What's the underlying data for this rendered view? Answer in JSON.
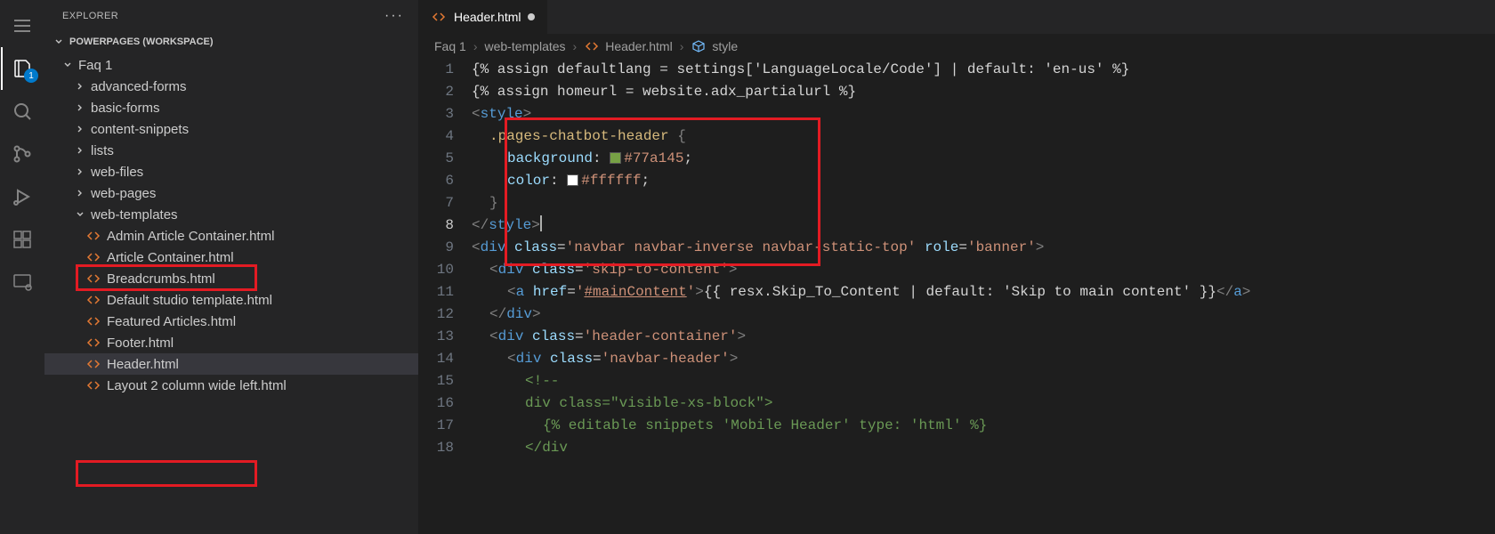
{
  "activityBar": {
    "explorerBadge": "1"
  },
  "sidebar": {
    "title": "EXPLORER",
    "section": "POWERPAGES (WORKSPACE)",
    "tree": [
      {
        "name": "Faq 1",
        "kind": "folder",
        "expanded": true,
        "depth": 0
      },
      {
        "name": "advanced-forms",
        "kind": "folder",
        "expanded": false,
        "depth": 1
      },
      {
        "name": "basic-forms",
        "kind": "folder",
        "expanded": false,
        "depth": 1
      },
      {
        "name": "content-snippets",
        "kind": "folder",
        "expanded": false,
        "depth": 1
      },
      {
        "name": "lists",
        "kind": "folder",
        "expanded": false,
        "depth": 1
      },
      {
        "name": "web-files",
        "kind": "folder",
        "expanded": false,
        "depth": 1
      },
      {
        "name": "web-pages",
        "kind": "folder",
        "expanded": false,
        "depth": 1
      },
      {
        "name": "web-templates",
        "kind": "folder",
        "expanded": true,
        "depth": 1
      },
      {
        "name": "Admin Article Container.html",
        "kind": "file",
        "depth": 2
      },
      {
        "name": "Article Container.html",
        "kind": "file",
        "depth": 2
      },
      {
        "name": "Breadcrumbs.html",
        "kind": "file",
        "depth": 2
      },
      {
        "name": "Default studio template.html",
        "kind": "file",
        "depth": 2
      },
      {
        "name": "Featured Articles.html",
        "kind": "file",
        "depth": 2
      },
      {
        "name": "Footer.html",
        "kind": "file",
        "depth": 2
      },
      {
        "name": "Header.html",
        "kind": "file",
        "depth": 2,
        "active": true
      },
      {
        "name": "Layout 2 column wide left.html",
        "kind": "file",
        "depth": 2
      }
    ]
  },
  "editor": {
    "tab": {
      "label": "Header.html",
      "dirty": true
    },
    "breadcrumb": [
      {
        "label": "Faq 1",
        "icon": null
      },
      {
        "label": "web-templates",
        "icon": null
      },
      {
        "label": "Header.html",
        "icon": "code"
      },
      {
        "label": "style",
        "icon": "block"
      }
    ],
    "code": {
      "l1": "{% assign defaultlang = settings['LanguageLocale/Code'] | default: 'en-us' %}",
      "l2": "{% assign homeurl = website.adx_partialurl %}",
      "l3_tag": "style",
      "l4_selector": ".pages-chatbot-header",
      "l5_prop": "background",
      "l5_val": "#77a145",
      "l6_prop": "color",
      "l6_val": "#ffffff",
      "l9_class": "navbar navbar-inverse navbar-static-top",
      "l9_role": "banner",
      "l10_class": "skip-to-content",
      "l11_href": "#mainContent",
      "l11_expr": "{{ resx.Skip_To_Content | default: 'Skip to main content' }}",
      "l13_class": "header-container",
      "l14_class": "navbar-header",
      "l16_class": "visible-xs-block",
      "l17_liquid": "{% editable snippets 'Mobile Header' type: 'html' %}"
    },
    "lineNumbers": [
      "1",
      "2",
      "3",
      "4",
      "5",
      "6",
      "7",
      "8",
      "9",
      "10",
      "11",
      "12",
      "13",
      "14",
      "15",
      "16",
      "17",
      "18"
    ]
  }
}
